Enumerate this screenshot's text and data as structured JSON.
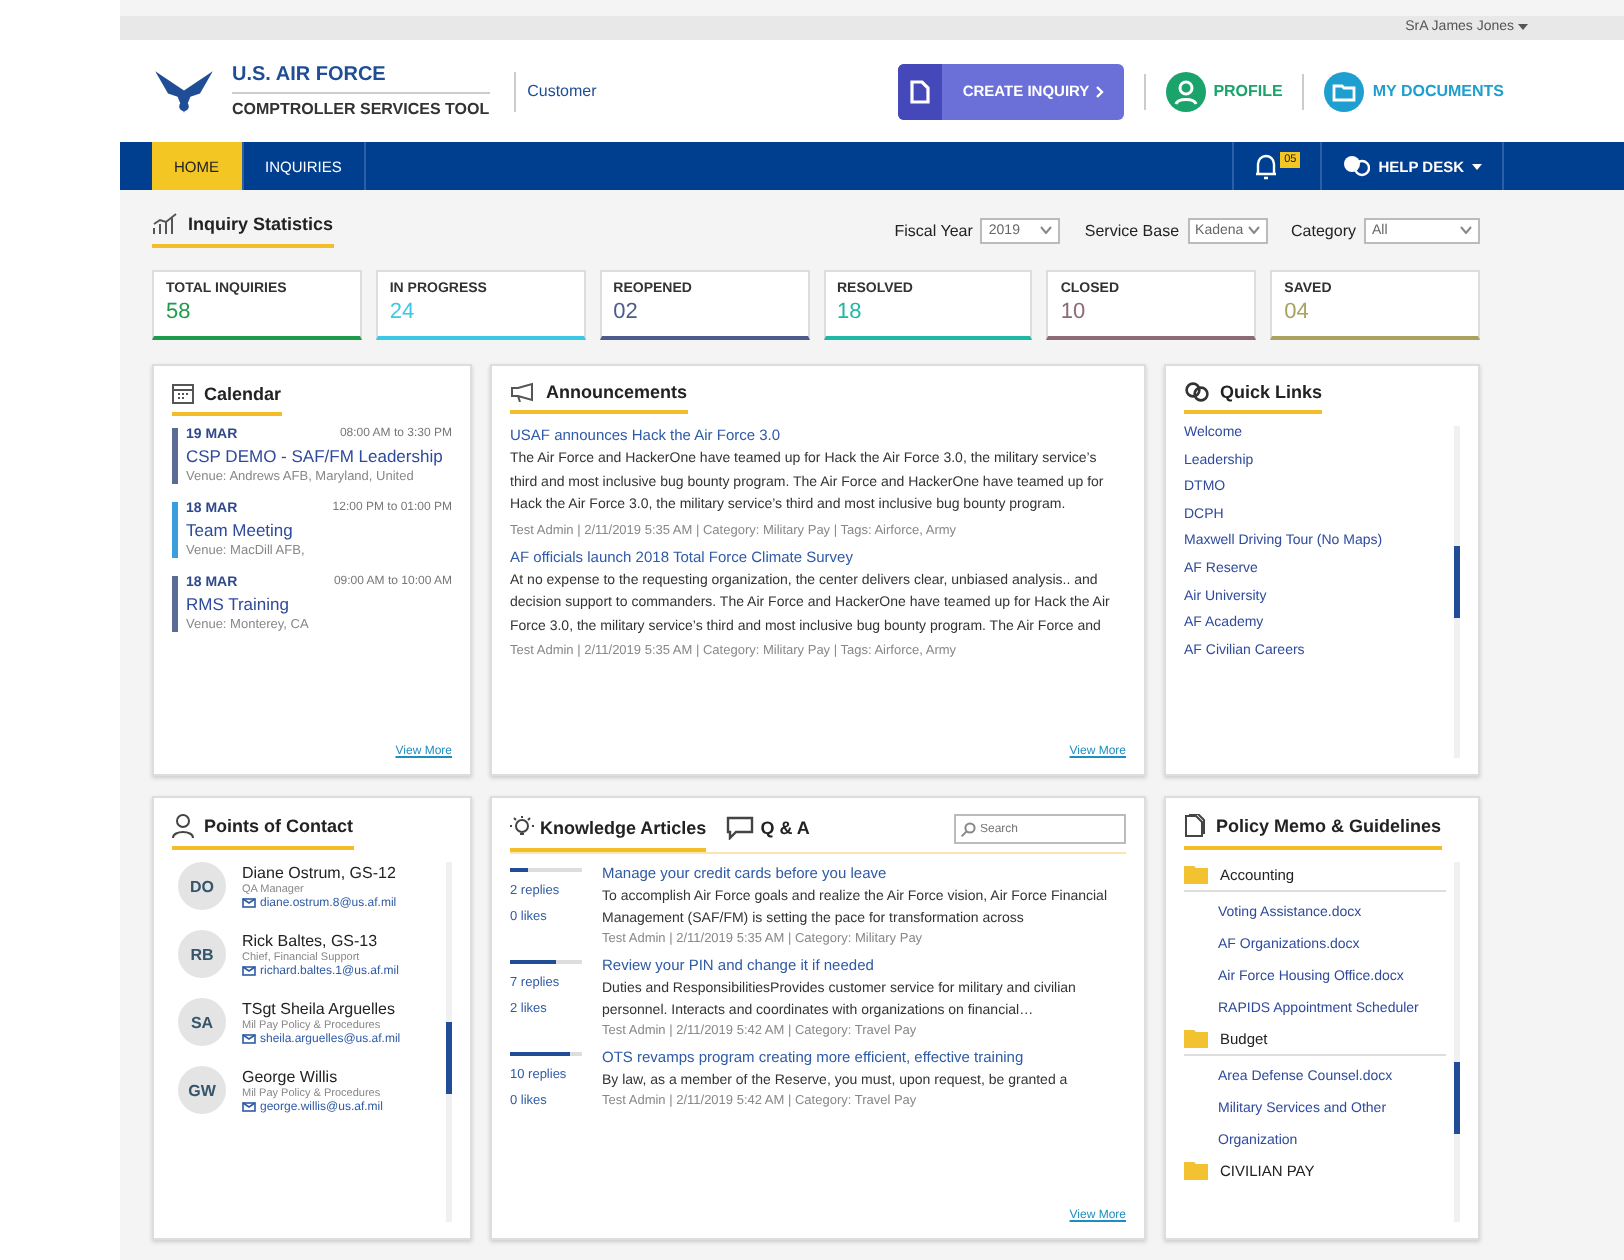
{
  "user_menu": {
    "label": "SrA James Jones"
  },
  "header": {
    "title": "U.S. AIR FORCE",
    "subtitle": "COMPTROLLER SERVICES TOOL",
    "role": "Customer",
    "create_button": "CREATE INQUIRY",
    "profile": "PROFILE",
    "documents": "MY DOCUMENTS"
  },
  "nav": {
    "tabs": [
      {
        "label": "HOME",
        "selected": true
      },
      {
        "label": "INQUIRIES",
        "selected": false
      }
    ],
    "notifications": "05",
    "help": "HELP DESK"
  },
  "statistics": {
    "title": "Inquiry Statistics",
    "filters": [
      {
        "label": "Fiscal Year",
        "value": "2019"
      },
      {
        "label": "Service Base",
        "value": "Kadena"
      },
      {
        "label": "Category",
        "value": "All"
      }
    ],
    "cards": [
      {
        "label": "TOTAL INQUIRIES",
        "value": "58",
        "color": "#1e9b4b"
      },
      {
        "label": "IN PROGRESS",
        "value": "24",
        "color": "#3cc8e4"
      },
      {
        "label": "REOPENED",
        "value": "02",
        "color": "#4d5b8c"
      },
      {
        "label": "RESOLVED",
        "value": "18",
        "color": "#1fb8a4"
      },
      {
        "label": "CLOSED",
        "value": "10",
        "color": "#8c6b74"
      },
      {
        "label": "SAVED",
        "value": "04",
        "color": "#aaa25e"
      }
    ]
  },
  "calendar": {
    "title": "Calendar",
    "events": [
      {
        "date": "19 MAR",
        "time": "08:00 AM to 3:30 PM",
        "title": "CSP DEMO - SAF/FM Leadership",
        "venue": "Venue: Andrews AFB, Maryland, United",
        "color": "#5c6a96"
      },
      {
        "date": "18 MAR",
        "time": "12:00 PM to 01:00 PM",
        "title": "Team Meeting",
        "venue": "Venue: MacDill AFB,",
        "color": "#3b9ddb"
      },
      {
        "date": "18 MAR",
        "time": "09:00 AM to 10:00 AM",
        "title": "RMS Training",
        "venue": "Venue: Monterey, CA",
        "color": "#5c6a96"
      }
    ],
    "more": "View More"
  },
  "announcements": {
    "title": "Announcements",
    "items": [
      {
        "title": "USAF announces Hack the Air Force 3.0",
        "body": "The Air Force and HackerOne have teamed up for Hack the Air Force 3.0, the military service’s third and most inclusive bug bounty program. The Air Force and HackerOne have teamed up for Hack the Air Force 3.0, the military service’s third and most inclusive bug bounty program.",
        "meta": "Test Admin | 2/11/2019 5:35 AM | Category: Military Pay | Tags: Airforce, Army"
      },
      {
        "title": "AF officials launch 2018 Total Force Climate Survey",
        "body": "At no expense to the requesting organization, the center delivers clear, unbiased analysis.. and decision support to commanders. The Air Force and HackerOne have teamed up for Hack the Air Force 3.0, the military service’s third and most inclusive bug bounty program. The Air Force and",
        "meta": "Test Admin | 2/11/2019 5:35 AM | Category: Military Pay | Tags: Airforce, Army"
      }
    ],
    "more": "View More"
  },
  "quick_links": {
    "title": "Quick Links",
    "items": [
      "Welcome",
      "Leadership",
      "DTMO",
      "DCPH",
      "Maxwell Driving Tour (No Maps)",
      "AF Reserve",
      "Air University",
      "AF Academy",
      "AF Civilian Careers"
    ]
  },
  "contacts": {
    "title": "Points of Contact",
    "people": [
      {
        "initials": "DO",
        "name": "Diane Ostrum, GS-12",
        "role": "QA Manager",
        "email": "diane.ostrum.8@us.af.mil"
      },
      {
        "initials": "RB",
        "name": "Rick Baltes, GS-13",
        "role": "Chief, Financial Support",
        "email": "richard.baltes.1@us.af.mil"
      },
      {
        "initials": "SA",
        "name": "TSgt Sheila Arguelles",
        "role": "Mil Pay Policy & Procedures",
        "email": "sheila.arguelles@us.af.mil"
      },
      {
        "initials": "GW",
        "name": "George Willis",
        "role": "Mil Pay Policy & Procedures",
        "email": "george.willis@us.af.mil"
      }
    ]
  },
  "knowledge": {
    "tabs": [
      {
        "label": "Knowledge Articles",
        "selected": true
      },
      {
        "label": "Q & A",
        "selected": false
      }
    ],
    "search": {
      "placeholder": "Search"
    },
    "articles": [
      {
        "level": 0.25,
        "replies": "2 replies",
        "likes": "0 likes",
        "title": "Manage your credit cards before you leave",
        "body": "To accomplish Air Force goals and realize the Air Force vision, Air Force Financial Management (SAF/FM) is setting the pace for transformation across",
        "meta": "Test Admin | 2/11/2019 5:35 AM | Category: Military Pay"
      },
      {
        "level": 0.65,
        "replies": "7 replies",
        "likes": "2 likes",
        "title": "Review your PIN and change it if needed",
        "body": "Duties and ResponsibilitiesProvides customer service for military and civilian personnel. Interacts and coordinates with organizations on financial…",
        "meta": "Test Admin | 2/11/2019 5:42 AM | Category: Travel Pay"
      },
      {
        "level": 0.82,
        "replies": "10 replies",
        "likes": "0 likes",
        "title": "OTS revamps program creating more efficient, effective training",
        "body": "By law, as a member of the Reserve, you must, upon request, be granted a",
        "meta": "Test Admin | 2/11/2019 5:42 AM | Category: Travel Pay"
      }
    ],
    "more": "View More"
  },
  "policy": {
    "title": "Policy Memo & Guidelines",
    "folders": [
      {
        "name": "Accounting",
        "expanded": true,
        "children": [
          "Voting Assistance.docx",
          "AF Organizations.docx",
          "Air Force Housing Office.docx",
          "RAPIDS Appointment Scheduler"
        ]
      },
      {
        "name": "Budget",
        "expanded": true,
        "children": [
          "Area Defense Counsel.docx",
          "Military Services and Other Organization"
        ]
      },
      {
        "name": "CIVILIAN PAY",
        "expanded": false
      }
    ]
  }
}
